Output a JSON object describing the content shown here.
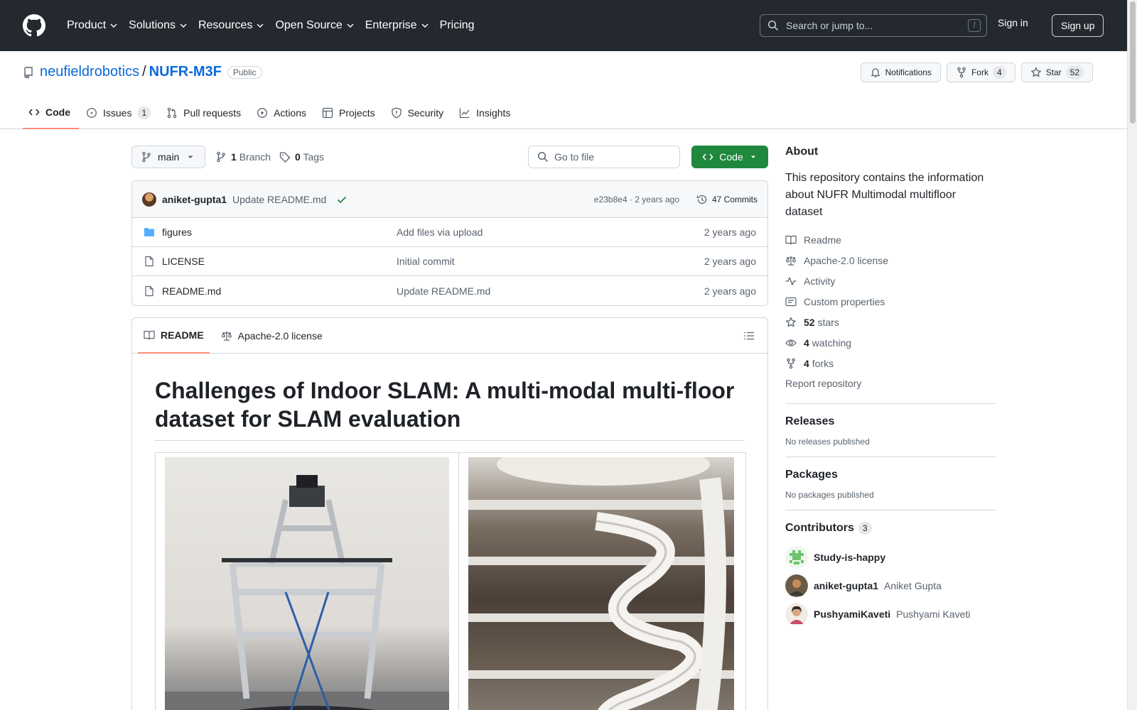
{
  "header": {
    "nav": [
      "Product",
      "Solutions",
      "Resources",
      "Open Source",
      "Enterprise",
      "Pricing"
    ],
    "search_placeholder": "Search or jump to...",
    "search_key": "/",
    "signin": "Sign in",
    "signup": "Sign up"
  },
  "repo": {
    "owner": "neufieldrobotics",
    "separator": "/",
    "name": "NUFR-M3F",
    "visibility": "Public",
    "notifications": "Notifications",
    "fork_label": "Fork",
    "fork_count": "4",
    "star_label": "Star",
    "star_count": "52"
  },
  "tabs": {
    "code": "Code",
    "issues": "Issues",
    "issues_count": "1",
    "pulls": "Pull requests",
    "actions": "Actions",
    "projects": "Projects",
    "security": "Security",
    "insights": "Insights"
  },
  "branchbar": {
    "branch": "main",
    "branch_count": "1",
    "branch_label": "Branch",
    "tag_count": "0",
    "tag_label": "Tags",
    "goto_placeholder": "Go to file",
    "code_button": "Code"
  },
  "commit": {
    "author": "aniket-gupta1",
    "message": "Update README.md",
    "meta": "e23b8e4 · 2 years ago",
    "commits": "47 Commits"
  },
  "files": [
    {
      "name": "figures",
      "type": "folder",
      "message": "Add files via upload",
      "date": "2 years ago"
    },
    {
      "name": "LICENSE",
      "type": "file",
      "message": "Initial commit",
      "date": "2 years ago"
    },
    {
      "name": "README.md",
      "type": "file",
      "message": "Update README.md",
      "date": "2 years ago"
    }
  ],
  "readme": {
    "tab_readme": "README",
    "tab_license": "Apache-2.0 license",
    "title": "Challenges of Indoor SLAM: A multi-modal multi-floor dataset for SLAM evaluation"
  },
  "about": {
    "heading": "About",
    "description": "This repository contains the information about NUFR Multimodal multifloor dataset",
    "readme": "Readme",
    "license": "Apache-2.0 license",
    "activity": "Activity",
    "custom_properties": "Custom properties",
    "stars_count": "52",
    "stars_label": "stars",
    "watching_count": "4",
    "watching_label": "watching",
    "forks_count": "4",
    "forks_label": "forks",
    "report": "Report repository"
  },
  "releases": {
    "heading": "Releases",
    "empty": "No releases published"
  },
  "packages": {
    "heading": "Packages",
    "empty": "No packages published"
  },
  "contributors": {
    "heading": "Contributors",
    "count": "3",
    "people": [
      {
        "login": "Study-is-happy",
        "name": ""
      },
      {
        "login": "aniket-gupta1",
        "name": "Aniket Gupta"
      },
      {
        "login": "PushyamiKaveti",
        "name": "Pushyami Kaveti"
      }
    ]
  },
  "colors": {
    "accent": "#0969da",
    "green": "#1f883d",
    "header": "#24292f",
    "tab_underline": "#fd8c73"
  }
}
